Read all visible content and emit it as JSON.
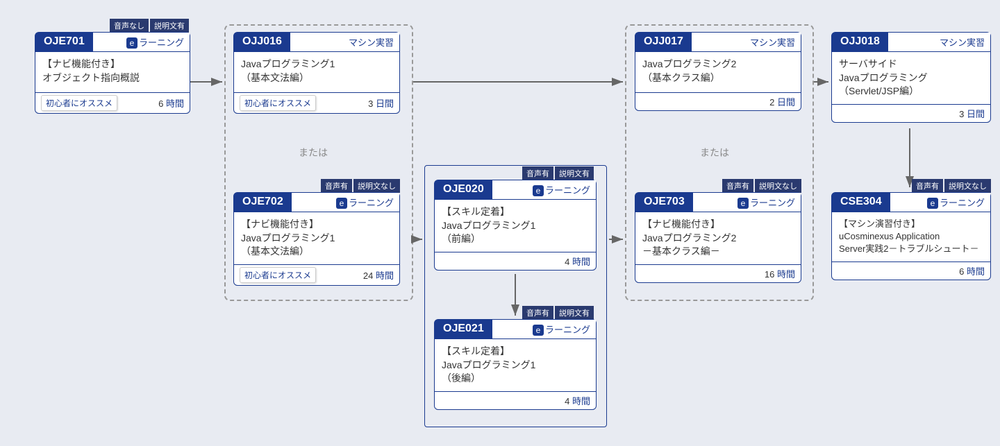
{
  "cards": {
    "oje701": {
      "code": "OJE701",
      "type": "ラーニング",
      "typeClass": "elearning",
      "title": "【ナビ機能付き】\nオブジェクト指向概説",
      "beginner": "初心者にオススメ",
      "dur": "6",
      "unit": "時間",
      "tags": [
        "音声なし",
        "説明文有"
      ]
    },
    "ojj016": {
      "code": "OJJ016",
      "type": "マシン実習",
      "typeClass": "",
      "title": "Javaプログラミング1\n（基本文法編）",
      "beginner": "初心者にオススメ",
      "dur": "3",
      "unit": "日間",
      "tags": []
    },
    "oje702": {
      "code": "OJE702",
      "type": "ラーニング",
      "typeClass": "elearning",
      "title": "【ナビ機能付き】\nJavaプログラミング1\n（基本文法編）",
      "beginner": "初心者にオススメ",
      "dur": "24",
      "unit": "時間",
      "tags": [
        "音声有",
        "説明文なし"
      ]
    },
    "oje020": {
      "code": "OJE020",
      "type": "ラーニング",
      "typeClass": "elearning",
      "title": "【スキル定着】\nJavaプログラミング1\n（前編）",
      "beginner": "",
      "dur": "4",
      "unit": "時間",
      "tags": [
        "音声有",
        "説明文有"
      ]
    },
    "oje021": {
      "code": "OJE021",
      "type": "ラーニング",
      "typeClass": "elearning",
      "title": "【スキル定着】\nJavaプログラミング1\n（後編）",
      "beginner": "",
      "dur": "4",
      "unit": "時間",
      "tags": [
        "音声有",
        "説明文有"
      ]
    },
    "ojj017": {
      "code": "OJJ017",
      "type": "マシン実習",
      "typeClass": "",
      "title": "Javaプログラミング2\n（基本クラス編）",
      "beginner": "",
      "dur": "2",
      "unit": "日間",
      "tags": []
    },
    "oje703": {
      "code": "OJE703",
      "type": "ラーニング",
      "typeClass": "elearning",
      "title": "【ナビ機能付き】\nJavaプログラミング2\n－基本クラス編－",
      "beginner": "",
      "dur": "16",
      "unit": "時間",
      "tags": [
        "音声有",
        "説明文なし"
      ]
    },
    "ojj018": {
      "code": "OJJ018",
      "type": "マシン実習",
      "typeClass": "",
      "title": "サーバサイド\nJavaプログラミング\n（Servlet/JSP編）",
      "beginner": "",
      "dur": "3",
      "unit": "日間",
      "tags": []
    },
    "cse304": {
      "code": "CSE304",
      "type": "ラーニング",
      "typeClass": "elearning",
      "title": "【マシン演習付き】\nuCosminexus Application\nServer実践2－トラブルシュート－",
      "beginner": "",
      "dur": "6",
      "unit": "時間",
      "tags": [
        "音声有",
        "説明文なし"
      ]
    }
  },
  "labels": {
    "or": "または"
  }
}
